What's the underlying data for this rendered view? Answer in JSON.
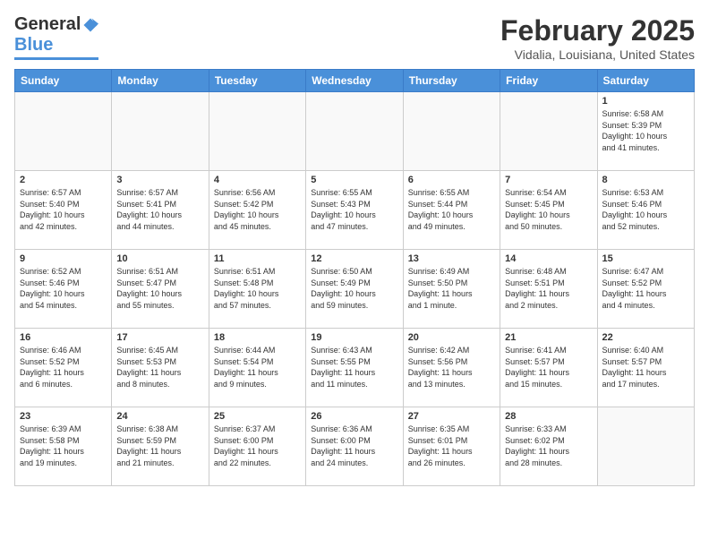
{
  "header": {
    "logo": {
      "general": "General",
      "blue": "Blue"
    },
    "title": "February 2025",
    "location": "Vidalia, Louisiana, United States"
  },
  "weekdays": [
    "Sunday",
    "Monday",
    "Tuesday",
    "Wednesday",
    "Thursday",
    "Friday",
    "Saturday"
  ],
  "weeks": [
    [
      {
        "day": "",
        "info": ""
      },
      {
        "day": "",
        "info": ""
      },
      {
        "day": "",
        "info": ""
      },
      {
        "day": "",
        "info": ""
      },
      {
        "day": "",
        "info": ""
      },
      {
        "day": "",
        "info": ""
      },
      {
        "day": "1",
        "info": "Sunrise: 6:58 AM\nSunset: 5:39 PM\nDaylight: 10 hours\nand 41 minutes."
      }
    ],
    [
      {
        "day": "2",
        "info": "Sunrise: 6:57 AM\nSunset: 5:40 PM\nDaylight: 10 hours\nand 42 minutes."
      },
      {
        "day": "3",
        "info": "Sunrise: 6:57 AM\nSunset: 5:41 PM\nDaylight: 10 hours\nand 44 minutes."
      },
      {
        "day": "4",
        "info": "Sunrise: 6:56 AM\nSunset: 5:42 PM\nDaylight: 10 hours\nand 45 minutes."
      },
      {
        "day": "5",
        "info": "Sunrise: 6:55 AM\nSunset: 5:43 PM\nDaylight: 10 hours\nand 47 minutes."
      },
      {
        "day": "6",
        "info": "Sunrise: 6:55 AM\nSunset: 5:44 PM\nDaylight: 10 hours\nand 49 minutes."
      },
      {
        "day": "7",
        "info": "Sunrise: 6:54 AM\nSunset: 5:45 PM\nDaylight: 10 hours\nand 50 minutes."
      },
      {
        "day": "8",
        "info": "Sunrise: 6:53 AM\nSunset: 5:46 PM\nDaylight: 10 hours\nand 52 minutes."
      }
    ],
    [
      {
        "day": "9",
        "info": "Sunrise: 6:52 AM\nSunset: 5:46 PM\nDaylight: 10 hours\nand 54 minutes."
      },
      {
        "day": "10",
        "info": "Sunrise: 6:51 AM\nSunset: 5:47 PM\nDaylight: 10 hours\nand 55 minutes."
      },
      {
        "day": "11",
        "info": "Sunrise: 6:51 AM\nSunset: 5:48 PM\nDaylight: 10 hours\nand 57 minutes."
      },
      {
        "day": "12",
        "info": "Sunrise: 6:50 AM\nSunset: 5:49 PM\nDaylight: 10 hours\nand 59 minutes."
      },
      {
        "day": "13",
        "info": "Sunrise: 6:49 AM\nSunset: 5:50 PM\nDaylight: 11 hours\nand 1 minute."
      },
      {
        "day": "14",
        "info": "Sunrise: 6:48 AM\nSunset: 5:51 PM\nDaylight: 11 hours\nand 2 minutes."
      },
      {
        "day": "15",
        "info": "Sunrise: 6:47 AM\nSunset: 5:52 PM\nDaylight: 11 hours\nand 4 minutes."
      }
    ],
    [
      {
        "day": "16",
        "info": "Sunrise: 6:46 AM\nSunset: 5:52 PM\nDaylight: 11 hours\nand 6 minutes."
      },
      {
        "day": "17",
        "info": "Sunrise: 6:45 AM\nSunset: 5:53 PM\nDaylight: 11 hours\nand 8 minutes."
      },
      {
        "day": "18",
        "info": "Sunrise: 6:44 AM\nSunset: 5:54 PM\nDaylight: 11 hours\nand 9 minutes."
      },
      {
        "day": "19",
        "info": "Sunrise: 6:43 AM\nSunset: 5:55 PM\nDaylight: 11 hours\nand 11 minutes."
      },
      {
        "day": "20",
        "info": "Sunrise: 6:42 AM\nSunset: 5:56 PM\nDaylight: 11 hours\nand 13 minutes."
      },
      {
        "day": "21",
        "info": "Sunrise: 6:41 AM\nSunset: 5:57 PM\nDaylight: 11 hours\nand 15 minutes."
      },
      {
        "day": "22",
        "info": "Sunrise: 6:40 AM\nSunset: 5:57 PM\nDaylight: 11 hours\nand 17 minutes."
      }
    ],
    [
      {
        "day": "23",
        "info": "Sunrise: 6:39 AM\nSunset: 5:58 PM\nDaylight: 11 hours\nand 19 minutes."
      },
      {
        "day": "24",
        "info": "Sunrise: 6:38 AM\nSunset: 5:59 PM\nDaylight: 11 hours\nand 21 minutes."
      },
      {
        "day": "25",
        "info": "Sunrise: 6:37 AM\nSunset: 6:00 PM\nDaylight: 11 hours\nand 22 minutes."
      },
      {
        "day": "26",
        "info": "Sunrise: 6:36 AM\nSunset: 6:00 PM\nDaylight: 11 hours\nand 24 minutes."
      },
      {
        "day": "27",
        "info": "Sunrise: 6:35 AM\nSunset: 6:01 PM\nDaylight: 11 hours\nand 26 minutes."
      },
      {
        "day": "28",
        "info": "Sunrise: 6:33 AM\nSunset: 6:02 PM\nDaylight: 11 hours\nand 28 minutes."
      },
      {
        "day": "",
        "info": ""
      }
    ]
  ]
}
